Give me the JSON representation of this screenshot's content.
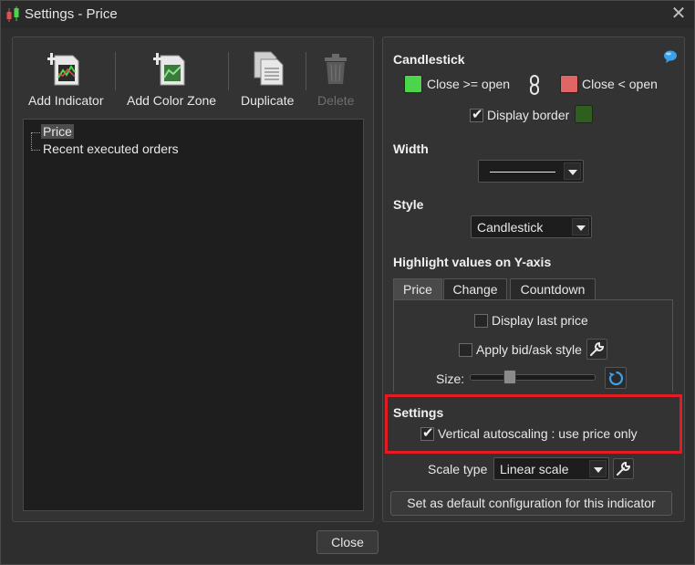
{
  "window": {
    "title": "Settings - Price"
  },
  "toolbar": {
    "add_indicator": "Add Indicator",
    "add_color_zone": "Add Color Zone",
    "duplicate": "Duplicate",
    "delete": "Delete"
  },
  "tree": {
    "items": [
      "Price",
      "Recent executed orders"
    ],
    "selected": "Price"
  },
  "candlestick": {
    "heading": "Candlestick",
    "up_label": "Close >= open",
    "down_label": "Close < open",
    "up_color": "#4cd44c",
    "down_color": "#e06666",
    "border_label": "Display border",
    "border_checked": true,
    "border_color": "#2f5f1e"
  },
  "width": {
    "heading": "Width"
  },
  "style": {
    "heading": "Style",
    "value": "Candlestick"
  },
  "highlight": {
    "heading": "Highlight values on Y-axis",
    "tabs": [
      "Price",
      "Change",
      "Countdown"
    ],
    "active_tab": "Price",
    "display_last_price": "Display last price",
    "apply_bid_ask": "Apply bid/ask style",
    "size_label": "Size:",
    "size_level": 0.3
  },
  "settings": {
    "heading": "Settings",
    "autoscale_label": "Vertical autoscaling : use price only",
    "autoscale_checked": true,
    "scale_type_label": "Scale type",
    "scale_type_value": "Linear scale",
    "default_button": "Set as default configuration for this indicator"
  },
  "footer": {
    "close": "Close"
  },
  "colors": {
    "highlight_border": "#e51b24",
    "help_icon": "#3aa0e8"
  }
}
